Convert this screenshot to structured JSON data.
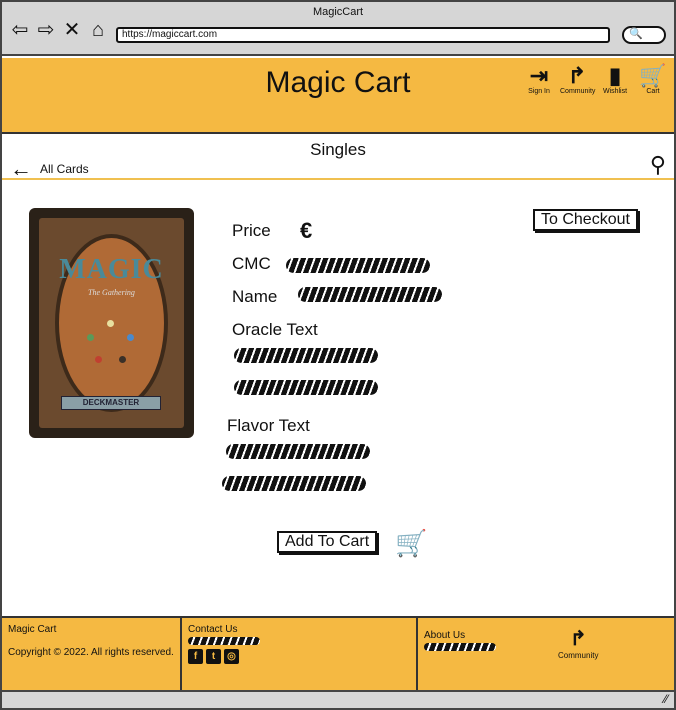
{
  "browser": {
    "title": "MagicCart",
    "url": "https://magiccart.com",
    "search_glyph": "🔍"
  },
  "header": {
    "brand": "Magic Cart",
    "nav": [
      {
        "label": "Sign In",
        "icon": "sign-in-icon",
        "glyph": "⇥"
      },
      {
        "label": "Community",
        "icon": "share-icon",
        "glyph": "↱"
      },
      {
        "label": "Wishlist",
        "icon": "bookmark-icon",
        "glyph": "▮"
      },
      {
        "label": "Cart",
        "icon": "cart-icon",
        "glyph": "🛒"
      }
    ]
  },
  "subnav": {
    "title": "Singles",
    "back_label": "All Cards"
  },
  "product": {
    "card_brand": "MAGIC",
    "card_subtitle": "The Gathering",
    "card_deck": "DECKMASTER",
    "price_label": "Price",
    "price_currency": "€",
    "cmc_label": "CMC",
    "name_label": "Name",
    "oracle_label": "Oracle Text",
    "flavor_label": "Flavor Text",
    "checkout_label": "To Checkout",
    "add_to_cart_label": "Add To Cart"
  },
  "footer": {
    "brand": "Magic Cart",
    "copyright": "Copyright © 2022. All rights reserved.",
    "contact_label": "Contact Us",
    "about_label": "About Us",
    "community_label": "Community"
  },
  "colors": {
    "accent": "#f5b942"
  }
}
